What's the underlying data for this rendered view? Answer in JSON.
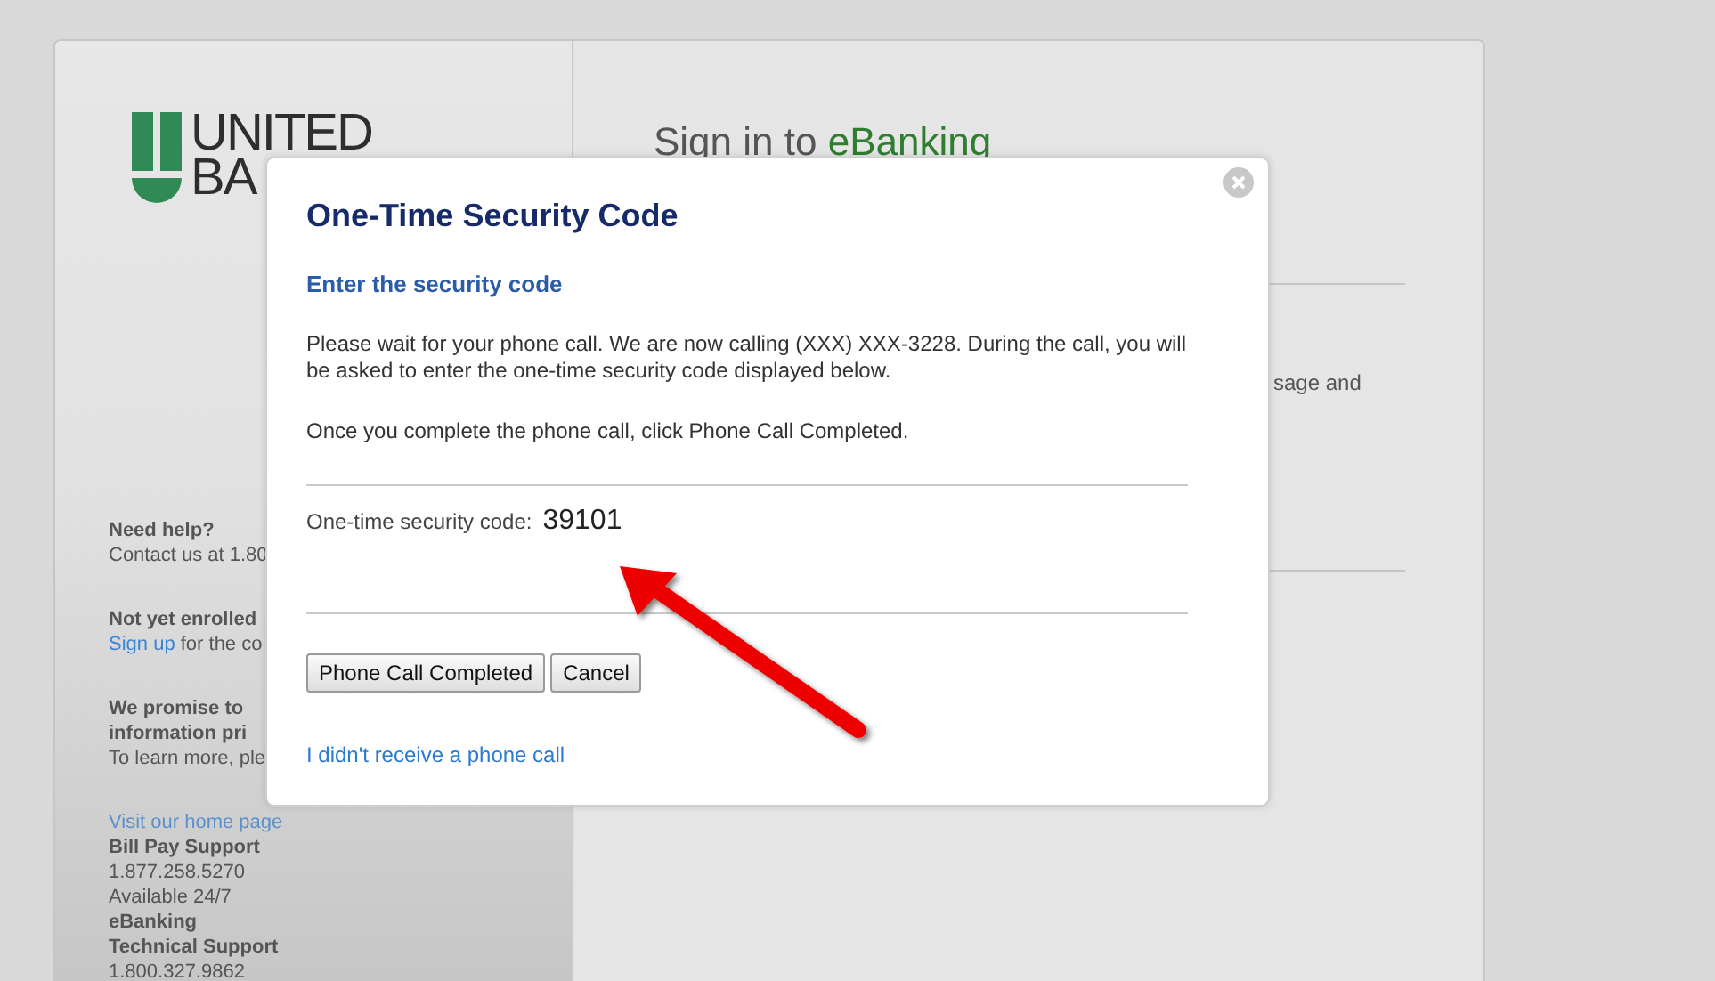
{
  "logo": {
    "line_1": "UNITED",
    "line_2": "BA"
  },
  "help_sections": [
    {
      "lines": [
        {
          "kind": "heading",
          "text": "Need help?"
        },
        {
          "kind": "text",
          "text": "Contact us at 1.80"
        }
      ]
    },
    {
      "lines": [
        {
          "kind": "heading",
          "text": "Not yet enrolled"
        },
        {
          "kind": "link_text",
          "link": "Sign up",
          "text": " for the co"
        }
      ]
    },
    {
      "lines": [
        {
          "kind": "heading",
          "text": "We promise to"
        },
        {
          "kind": "heading",
          "text": "information pri"
        },
        {
          "kind": "text",
          "text": "To learn more, ple"
        }
      ]
    },
    {
      "lines": [
        {
          "kind": "link",
          "text": "Visit our home page"
        },
        {
          "kind": "heading",
          "text": "Bill Pay Support"
        },
        {
          "kind": "text",
          "text": "1.877.258.5270"
        },
        {
          "kind": "text",
          "text": "Available 24/7"
        },
        {
          "kind": "heading",
          "text": "eBanking"
        },
        {
          "kind": "heading",
          "text": "Technical Support"
        },
        {
          "kind": "text",
          "text": "1.800.327.9862"
        }
      ]
    }
  ],
  "sign_in": {
    "title": "Sign in to ",
    "title_highlight": "eBanking",
    "partial_text": "sage and"
  },
  "dialog": {
    "title": "One-Time Security Code",
    "subtitle": "Enter the security code",
    "message": "Please wait for your phone call. We are now calling (XXX) XXX-3228. During the call, you will be asked to enter the one-time security code displayed below.",
    "instruction": "Once you complete the phone call, click Phone Call Completed.",
    "code_label": "One-time security code:",
    "code": "39101",
    "buttons": [
      "Phone Call Completed",
      "Cancel"
    ],
    "link": "I didn't receive a phone call"
  }
}
